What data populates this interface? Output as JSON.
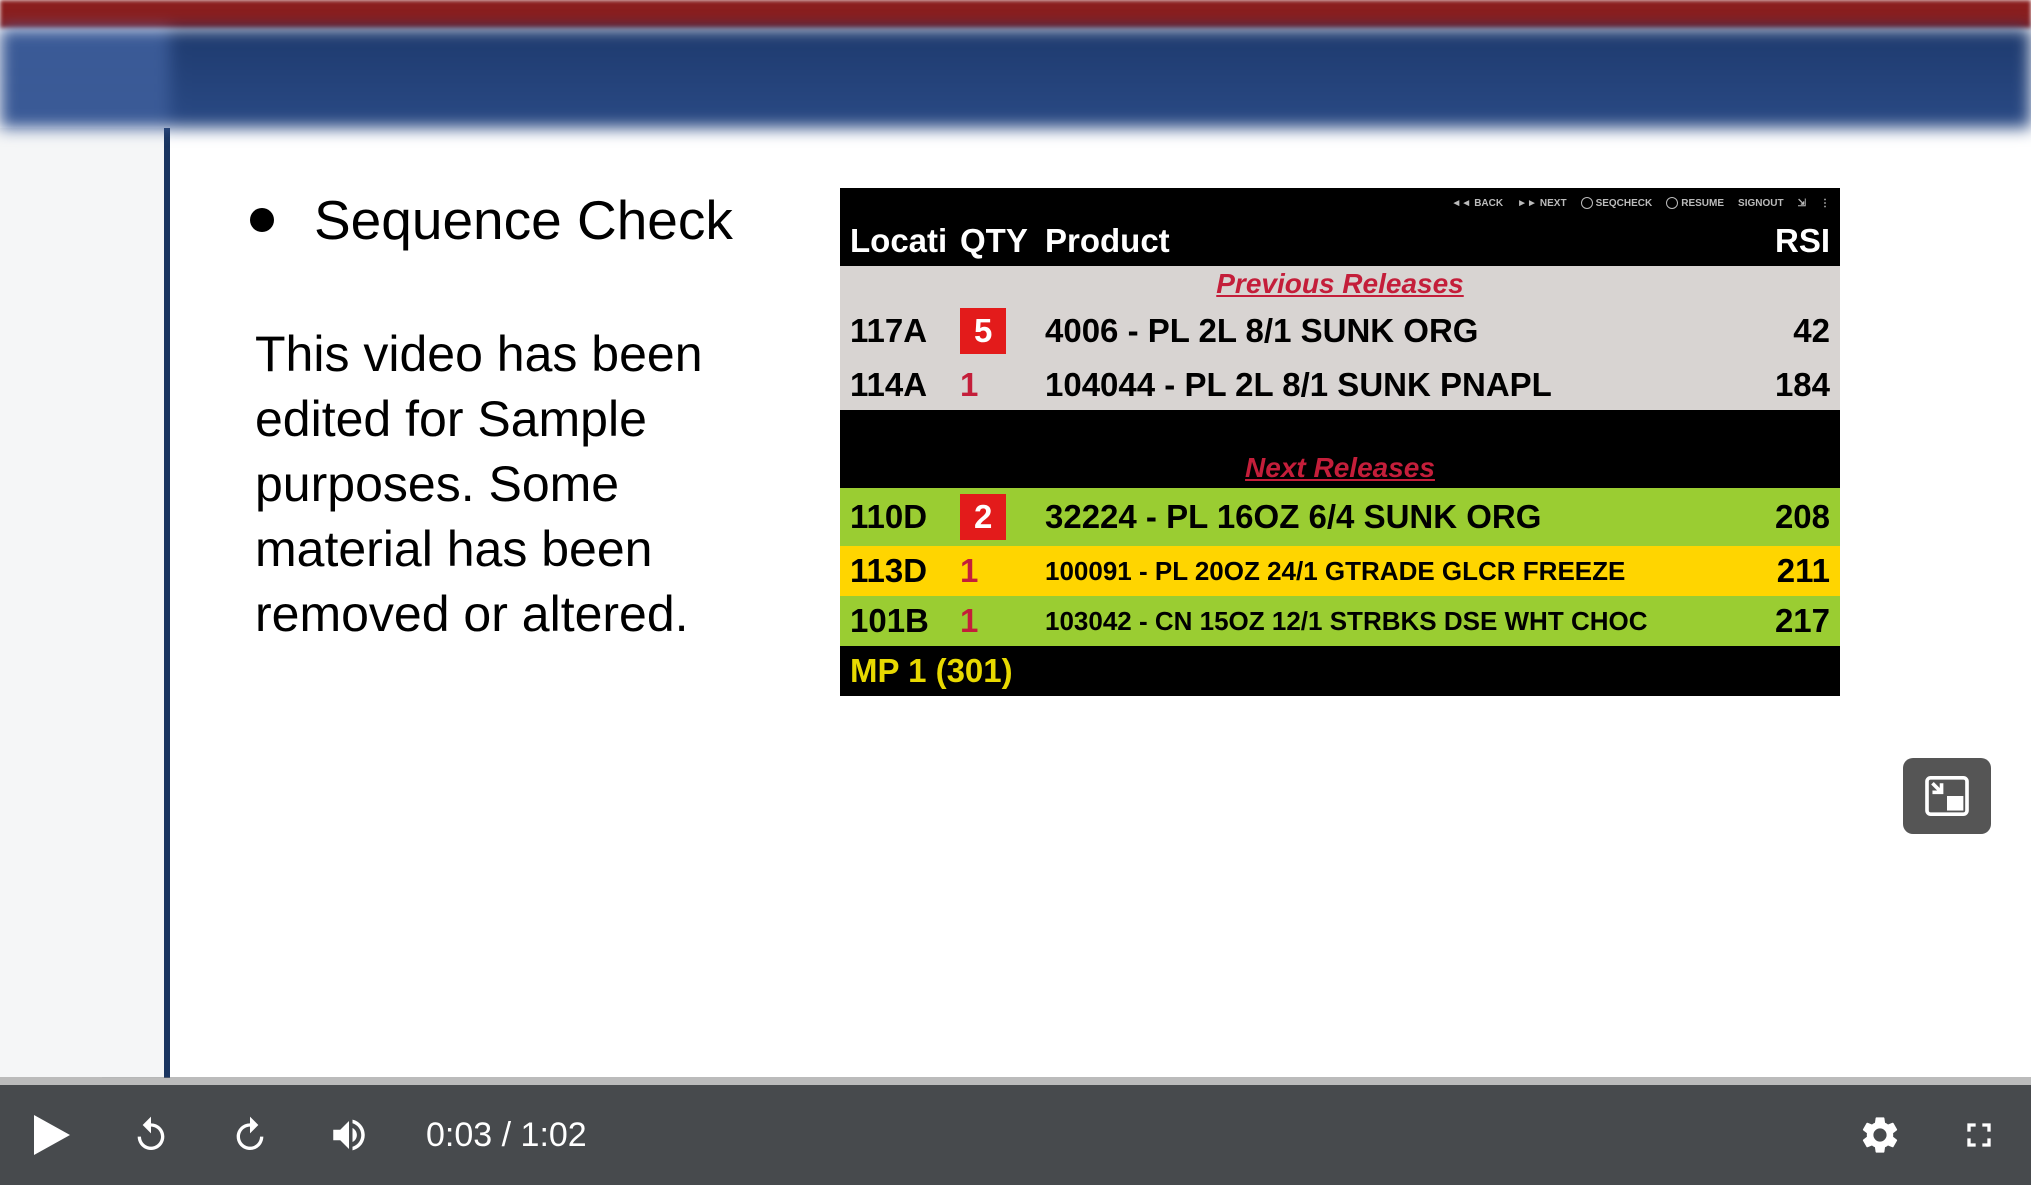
{
  "slide": {
    "bullet_title": "Sequence Check",
    "body": "This video has been edited for Sample purposes. Some material has been removed or altered."
  },
  "terminal": {
    "toolbar": {
      "back": "BACK",
      "next": "NEXT",
      "seqcheck": "SEQCHECK",
      "resume": "RESUME",
      "signout": "SIGNOUT"
    },
    "headers": {
      "location": "Locati",
      "qty": "QTY",
      "product": "Product",
      "rsi": "RSI"
    },
    "previous_label": "Previous Releases",
    "next_label": "Next Releases",
    "previous": [
      {
        "loc": "117A",
        "qty": "5",
        "qty_style": "box",
        "product": "4006 - PL 2L 8/1 SUNK ORG",
        "rsi": "42"
      },
      {
        "loc": "114A",
        "qty": "1",
        "qty_style": "red",
        "product": "104044 - PL 2L 8/1 SUNK PNAPL",
        "rsi": "184"
      }
    ],
    "next": [
      {
        "loc": "110D",
        "qty": "2",
        "qty_style": "box",
        "product": "32224 - PL 16OZ 6/4 SUNK ORG",
        "rsi": "208",
        "row_color": "green"
      },
      {
        "loc": "113D",
        "qty": "1",
        "qty_style": "red",
        "product": "100091 - PL 20OZ 24/1 GTRADE GLCR FREEZE",
        "rsi": "211",
        "row_color": "yellow",
        "small": true
      },
      {
        "loc": "101B",
        "qty": "1",
        "qty_style": "red",
        "product": "103042 - CN 15OZ 12/1 STRBKS DSE WHT CHOC",
        "rsi": "217",
        "row_color": "green",
        "small": true
      }
    ],
    "footer": "MP 1 (301)"
  },
  "player": {
    "current_time": "0:03",
    "duration": "1:02"
  }
}
